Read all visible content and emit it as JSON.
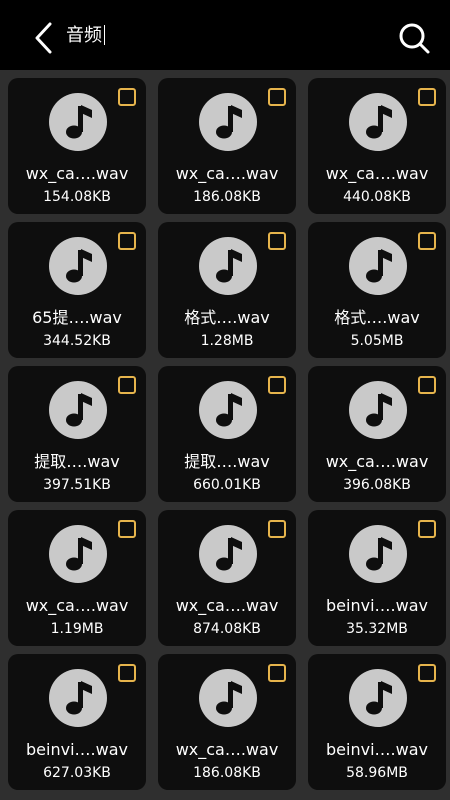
{
  "header": {
    "title": "音频",
    "back_icon": "chevron-left-icon",
    "search_icon": "search-icon"
  },
  "colors": {
    "header_bg": "#000000",
    "page_bg": "#2e2e2e",
    "tile_bg": "#0e0e0e",
    "icon_circle": "#c9c9c9",
    "checkbox_border": "#e6b44c",
    "text": "#ffffff"
  },
  "files": [
    {
      "name": "wx_ca….wav",
      "size": "154.08KB",
      "checked": false
    },
    {
      "name": "wx_ca….wav",
      "size": "186.08KB",
      "checked": false
    },
    {
      "name": "wx_ca….wav",
      "size": "440.08KB",
      "checked": false
    },
    {
      "name": "65提….wav",
      "size": "344.52KB",
      "checked": false
    },
    {
      "name": "格式….wav",
      "size": "1.28MB",
      "checked": false
    },
    {
      "name": "格式….wav",
      "size": "5.05MB",
      "checked": false
    },
    {
      "name": "提取….wav",
      "size": "397.51KB",
      "checked": false
    },
    {
      "name": "提取….wav",
      "size": "660.01KB",
      "checked": false
    },
    {
      "name": "wx_ca….wav",
      "size": "396.08KB",
      "checked": false
    },
    {
      "name": "wx_ca….wav",
      "size": "1.19MB",
      "checked": false
    },
    {
      "name": "wx_ca….wav",
      "size": "874.08KB",
      "checked": false
    },
    {
      "name": "beinvi….wav",
      "size": "35.32MB",
      "checked": false
    },
    {
      "name": "beinvi….wav",
      "size": "627.03KB",
      "checked": false
    },
    {
      "name": "wx_ca….wav",
      "size": "186.08KB",
      "checked": false
    },
    {
      "name": "beinvi….wav",
      "size": "58.96MB",
      "checked": false
    }
  ]
}
